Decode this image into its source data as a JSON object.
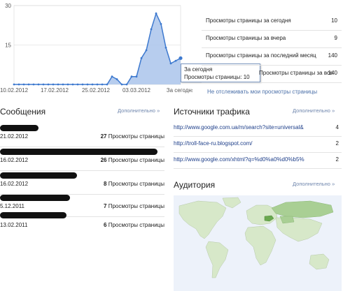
{
  "chart_data": {
    "type": "area",
    "x_ticks": [
      "10.02.2012",
      "17.02.2012",
      "25.02.2012",
      "03.03.2012",
      "За сегодня"
    ],
    "y_ticks": [
      15,
      30
    ],
    "ylim": [
      0,
      30
    ],
    "values": [
      0,
      0,
      0,
      0,
      0,
      0,
      0,
      0,
      0,
      0,
      0,
      0,
      0,
      0,
      0,
      0,
      0,
      0,
      0,
      0,
      3,
      2,
      0,
      0,
      3,
      3,
      10,
      13,
      21,
      27,
      23,
      14,
      8,
      9,
      10
    ],
    "colors": {
      "line": "#3d79cf",
      "fill": "#aac4eb"
    }
  },
  "tooltip": {
    "line1": "За сегодня",
    "line2": "Просмотры страницы: 10"
  },
  "stats": [
    {
      "label": "Просмотры страницы за сегодня",
      "value": "10"
    },
    {
      "label": "Просмотры страницы за вчера",
      "value": "9"
    },
    {
      "label": "Просмотры страницы за последний месяц",
      "value": "140"
    },
    {
      "label": "Просмотры страницы за все",
      "value": "140"
    }
  ],
  "untrack_link": "Не отслеживать мои просмотры страницы",
  "messages": {
    "title": "Сообщения",
    "more": "Дополнительно »",
    "items": [
      {
        "date": "21.02.2012",
        "count": "27",
        "suffix": " Просмотры страницы"
      },
      {
        "date": "16.02.2012",
        "count": "26",
        "suffix": " Просмотры страницы"
      },
      {
        "date": "16.02.2012",
        "count": "8",
        "suffix": " Просмотры страницы"
      },
      {
        "date": "5.12.2011",
        "count": "7",
        "suffix": " Просмотры страницы"
      },
      {
        "date": "13.02.2011",
        "count": "6",
        "suffix": " Просмотры страницы"
      }
    ]
  },
  "traffic": {
    "title": "Источники трафика",
    "more": "Дополнительно »",
    "items": [
      {
        "url": "http://www.google.com.ua/m/search?site=universal&",
        "count": "4"
      },
      {
        "url": "http://troll-face-ru.blogspot.com/",
        "count": "2"
      },
      {
        "url": "http://www.google.com/xhtml?q=%d0%a0%d0%b5%",
        "count": "2"
      }
    ]
  },
  "audience": {
    "title": "Аудитория",
    "more": "Дополнительно »"
  }
}
